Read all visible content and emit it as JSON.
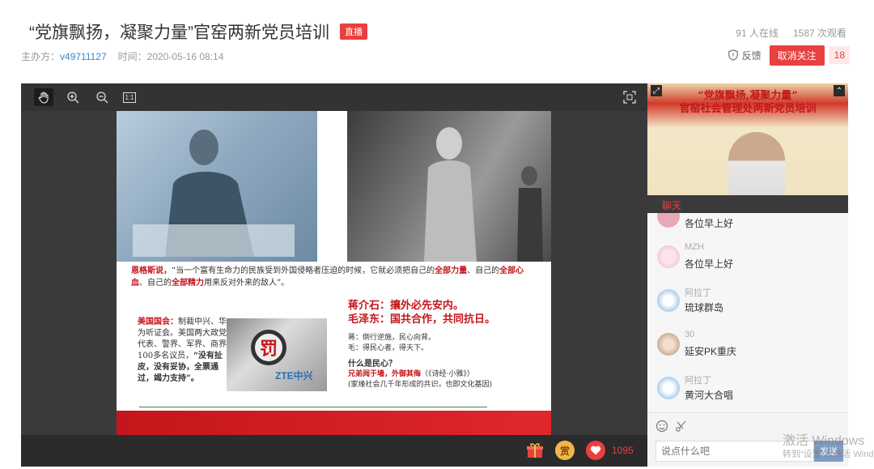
{
  "header": {
    "title": "“党旗飘扬，凝聚力量”官窑两新党员培训",
    "live_badge": "直播",
    "host_label": "主办方：",
    "host_value": "v49711127",
    "time_label": "时间：",
    "time_value": "2020-05-16 08:14",
    "online": "91 人在线",
    "views": "1587 次观看",
    "feedback": "反馈",
    "unfollow": "取消关注",
    "follow_count": "18"
  },
  "slide": {
    "quote_prefix": "恩格斯说，",
    "quote_part1": "“当一个富有生命力的民族受到外国侵略者压迫的时候，它就必须把自己的",
    "quote_red1": "全部力量",
    "quote_part2": "、自己的",
    "quote_red2": "全部心血",
    "quote_part3": "、自己的",
    "quote_red3": "全部精力",
    "quote_part4": "用来反对外来的敌人”。",
    "congress_label": "美国国会：",
    "congress_text": "制裁中兴、华为听证会。美国两大政党代表、警界、军界、商界100多名议员，",
    "congress_bold": "“没有扯皮，没有妥协，全票通过，竭力支持”。",
    "fa_char": "罚",
    "zte_text": "ZTE中兴",
    "chiang": "蒋介石：攘外必先安内。",
    "mao": "毛泽东：国共合作，共同抗日。",
    "chiang_note": "蒋：倒行逆施，民心向背。",
    "mao_note": "毛：得民心者，得天下。",
    "question": "什么是民心？",
    "proverb": "兄弟阋于墙，外御其侮",
    "proverb_src": "（《诗经·小雅》）",
    "proverb_note": "(家缘社会几千年形成的共识，也即文化基因)"
  },
  "player": {
    "like_count": "1095",
    "reward_char": "赏"
  },
  "video": {
    "banner1": "“党旗飘扬,凝聚力量”",
    "banner2": "官窑社会管理处两新党员培训"
  },
  "chat": {
    "tab": "聊天",
    "messages": [
      {
        "name": "",
        "text": "各位早上好"
      },
      {
        "name": "MZH",
        "text": "各位早上好"
      },
      {
        "name": "阿拉丁",
        "text": "琉球群岛"
      },
      {
        "name": "30",
        "text": "延安PK重庆"
      },
      {
        "name": "阿拉丁",
        "text": "黄河大合唱"
      }
    ],
    "input_placeholder": "说点什么吧",
    "send": "发送"
  },
  "watermark": {
    "line1": "激活 Windows",
    "line2": "转到“设置”以激活 Windows"
  },
  "colors": {
    "accent": "#e8403f",
    "link": "#2f88d6"
  }
}
